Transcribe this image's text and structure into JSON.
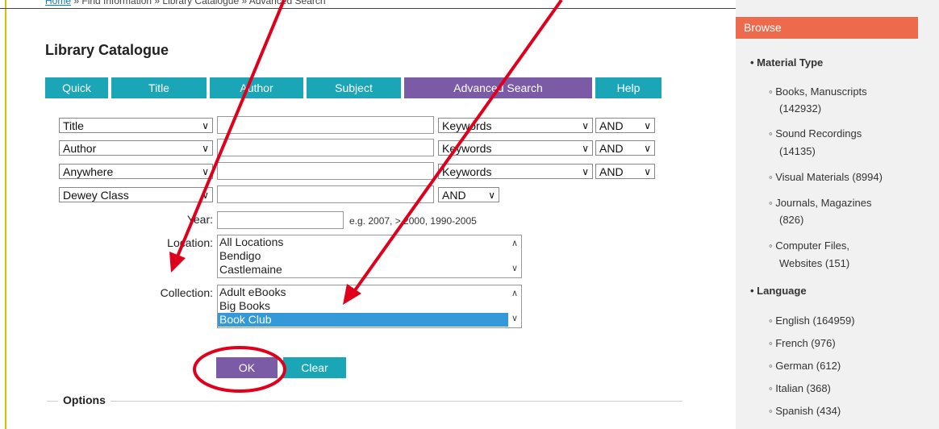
{
  "breadcrumb": {
    "home": "Home",
    "rest": " » Find Information » Library Catalogue » Advanced Search"
  },
  "page_title": "Library Catalogue",
  "tabs": [
    {
      "label": "Quick"
    },
    {
      "label": "Title"
    },
    {
      "label": "Author"
    },
    {
      "label": "Subject"
    },
    {
      "label": "Advanced Search"
    },
    {
      "label": "Help"
    }
  ],
  "search_rows": [
    {
      "field": "Title",
      "mode": "Keywords",
      "op": "AND",
      "value": ""
    },
    {
      "field": "Author",
      "mode": "Keywords",
      "op": "AND",
      "value": ""
    },
    {
      "field": "Anywhere",
      "mode": "Keywords",
      "op": "AND",
      "value": ""
    },
    {
      "field": "Dewey Class",
      "op": "AND",
      "value": ""
    }
  ],
  "year": {
    "label": "Year:",
    "hint": "e.g. 2007, > 2000, 1990-2005",
    "value": ""
  },
  "location": {
    "label": "Location:",
    "options": [
      "All Locations",
      "Bendigo",
      "Castlemaine"
    ]
  },
  "collection": {
    "label": "Collection:",
    "options": [
      "Adult eBooks",
      "Big Books",
      "Book Club"
    ],
    "selected": "Book Club"
  },
  "buttons": {
    "ok": "OK",
    "clear": "Clear"
  },
  "options_label": "Options",
  "browse": {
    "title": "Browse",
    "sections": [
      {
        "heading": "Material Type",
        "items": [
          [
            "Books, Manuscripts",
            "(142932)"
          ],
          [
            "Sound Recordings",
            "(14135)"
          ],
          [
            "Visual Materials (8994)"
          ],
          [
            "Journals, Magazines",
            "(826)"
          ],
          [
            "Computer Files,",
            "Websites (151)"
          ]
        ]
      },
      {
        "heading": "Language",
        "items": [
          [
            "English (164959)"
          ],
          [
            "French (976)"
          ],
          [
            "German (612)"
          ],
          [
            "Italian (368)"
          ],
          [
            "Spanish (434)"
          ]
        ]
      }
    ]
  },
  "colors": {
    "tab": "#1aa6b7",
    "tab_active": "#7b5aa6",
    "ok": "#7b5aa6",
    "clear": "#1aa6b7",
    "browse": "#ee6a4c",
    "annotation": "#e0001b"
  }
}
